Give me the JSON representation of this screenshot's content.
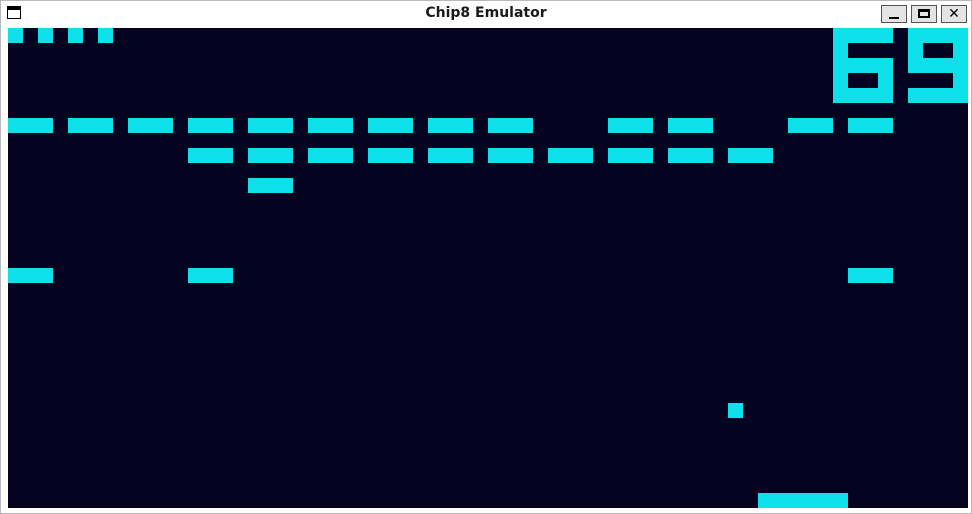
{
  "window": {
    "title": "Chip8 Emulator",
    "controls": {
      "minimize": "minimize",
      "maximize": "maximize",
      "close": "✕"
    }
  },
  "display": {
    "resolution": [
      64,
      32
    ],
    "background": "#04021f",
    "foreground": "#0ee0ea"
  },
  "game": {
    "score": "69",
    "lives": 4,
    "bricks": [
      {
        "col": 0,
        "row": 6
      },
      {
        "col": 4,
        "row": 6
      },
      {
        "col": 8,
        "row": 6
      },
      {
        "col": 12,
        "row": 6
      },
      {
        "col": 16,
        "row": 6
      },
      {
        "col": 20,
        "row": 6
      },
      {
        "col": 24,
        "row": 6
      },
      {
        "col": 28,
        "row": 6
      },
      {
        "col": 32,
        "row": 6
      },
      {
        "col": 40,
        "row": 6
      },
      {
        "col": 44,
        "row": 6
      },
      {
        "col": 52,
        "row": 6
      },
      {
        "col": 56,
        "row": 6
      },
      {
        "col": 12,
        "row": 8
      },
      {
        "col": 16,
        "row": 8
      },
      {
        "col": 20,
        "row": 8
      },
      {
        "col": 24,
        "row": 8
      },
      {
        "col": 28,
        "row": 8
      },
      {
        "col": 32,
        "row": 8
      },
      {
        "col": 36,
        "row": 8
      },
      {
        "col": 40,
        "row": 8
      },
      {
        "col": 44,
        "row": 8
      },
      {
        "col": 48,
        "row": 8
      },
      {
        "col": 16,
        "row": 10
      },
      {
        "col": 0,
        "row": 16
      },
      {
        "col": 12,
        "row": 16
      },
      {
        "col": 56,
        "row": 16
      }
    ],
    "ball": {
      "col": 48,
      "row": 25
    },
    "paddle": {
      "col": 50,
      "row": 31,
      "width": 6
    }
  }
}
